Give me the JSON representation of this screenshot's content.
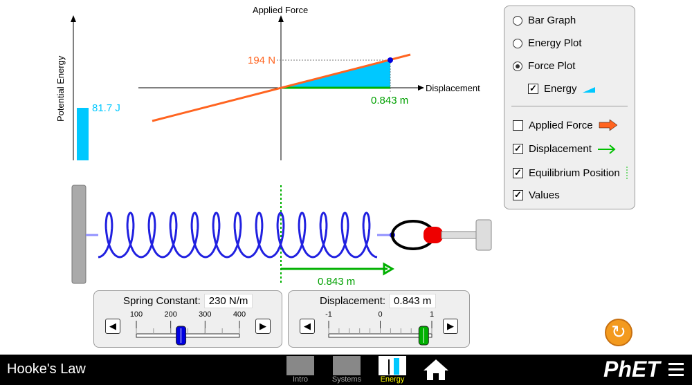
{
  "energy_bar": {
    "axis_label": "Potential Energy",
    "value_label": "81.7 J",
    "value": 81.7,
    "color": "#00c8ff"
  },
  "force_plot": {
    "y_label": "Applied Force",
    "x_label": "Displacement",
    "force_label": "194 N",
    "displacement_label": "0.843 m",
    "force": 194,
    "displacement": 0.843,
    "line_color": "#ff6420",
    "area_color": "#00c8ff",
    "disp_color": "#00b000"
  },
  "spring": {
    "displacement_label": "0.843 m"
  },
  "panel": {
    "views": [
      {
        "label": "Bar Graph",
        "selected": false
      },
      {
        "label": "Energy Plot",
        "selected": false
      },
      {
        "label": "Force Plot",
        "selected": true
      }
    ],
    "energy": {
      "label": "Energy",
      "checked": true
    },
    "options": [
      {
        "label": "Applied Force",
        "checked": false
      },
      {
        "label": "Displacement",
        "checked": true
      },
      {
        "label": "Equilibrium Position",
        "checked": true
      },
      {
        "label": "Values",
        "checked": true
      }
    ]
  },
  "spring_constant": {
    "label": "Spring Constant:",
    "value": "230 N/m",
    "ticks": [
      "100",
      "200",
      "300",
      "400"
    ],
    "min": 100,
    "max": 400,
    "current": 230
  },
  "displacement": {
    "label": "Displacement:",
    "value": "0.843 m",
    "ticks": [
      "-1",
      "0",
      "1"
    ],
    "min": -1,
    "max": 1,
    "current": 0.843
  },
  "nav": {
    "title": "Hooke's Law",
    "tabs": [
      {
        "label": "Intro"
      },
      {
        "label": "Systems"
      },
      {
        "label": "Energy",
        "active": true
      }
    ],
    "brand": "PhET"
  }
}
